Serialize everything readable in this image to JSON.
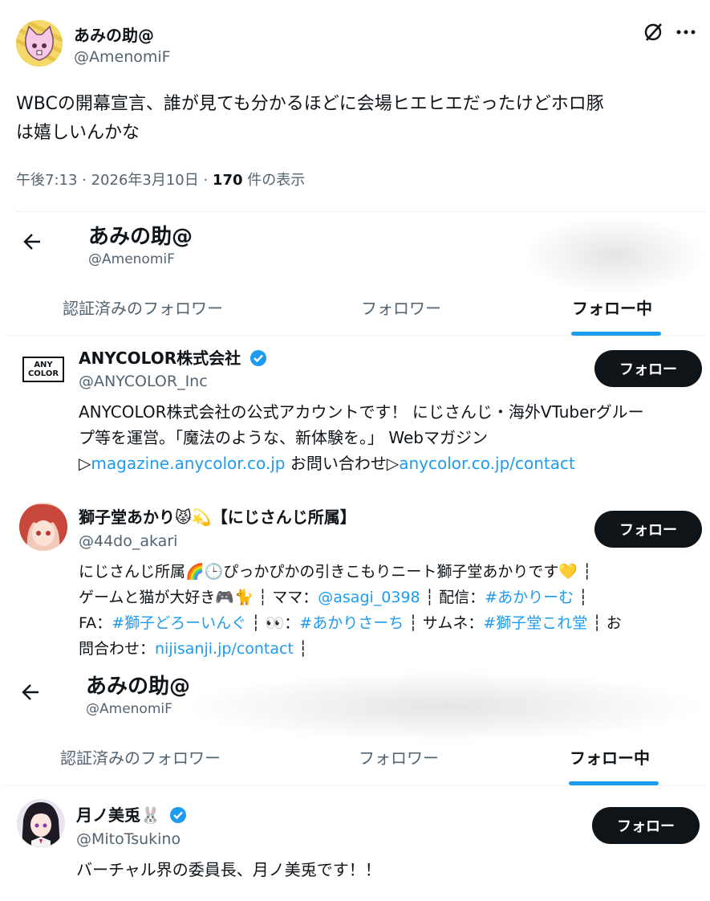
{
  "tweet": {
    "author_name": "あみの助@",
    "author_handle": "@AmenomiF",
    "text_line1": "WBCの開幕宣言、誰が見ても分かるほどに会場ヒエヒエだったけどホロ豚",
    "text_line2": "は嬉しいんかな",
    "time": "午後7:13 · 2026年3月10日 · ",
    "views_count": "170",
    "views_label": " 件の表示",
    "more_icon": "more-horizontal-icon",
    "grok_icon": "slash-circle-icon"
  },
  "screenshot1": {
    "back_icon": "arrow-left-icon",
    "profile_name": "あみの助@",
    "profile_handle": "@AmenomiF",
    "tabs": [
      "認証済みのフォロワー",
      "フォロワー",
      "フォロー中"
    ],
    "users": [
      {
        "name": "ANYCOLOR株式会社",
        "handle": "@ANYCOLOR_Inc",
        "follow": "フォロー",
        "logo_line1": "ANY",
        "logo_line2": "COLOR",
        "bio_l1": "ANYCOLOR株式会社の公式アカウントです！ にじさんじ・海外VTuberグルー",
        "bio_l2": "プ等を運営。「魔法のような、新体験を。」 Webマガジン",
        "bio_l3_a": "▷",
        "bio_l3_link1": "magazine.anycolor.co.jp",
        "bio_l3_b": " お問い合わせ▷",
        "bio_l3_link2": "anycolor.co.jp/contact"
      },
      {
        "name": "獅子堂あかり😾💫【にじさんじ所属】",
        "handle": "@44do_akari",
        "follow": "フォロー",
        "bio_l1": "にじさんじ所属🌈🕒ぴっかぴかの引きこもりニート獅子堂あかりです💛 ┆",
        "bio_l2_a": "ゲームと猫が大好き🎮🐈 ┆ ママ：",
        "bio_l2_link": "@asagi_0398",
        "bio_l2_b": " ┆ 配信：",
        "bio_l2_link2": "#あかりーむ",
        "bio_l2_c": " ┆",
        "bio_l3_a": "FA：",
        "bio_l3_link1": "#獅子どろーいんぐ",
        "bio_l3_b": " ┆ 👀：",
        "bio_l3_link2": "#あかりさーち",
        "bio_l3_c": " ┆ サムネ：",
        "bio_l3_link3": "#獅子堂これ堂",
        "bio_l3_d": " ┆ お",
        "bio_l4_a": "問合わせ：",
        "bio_l4_link": "nijisanji.jp/contact",
        "bio_l4_b": " ┆"
      }
    ]
  },
  "screenshot2": {
    "back_icon": "arrow-left-icon",
    "profile_name": "あみの助@",
    "profile_handle": "@AmenomiF",
    "tabs": [
      "認証済みのフォロワー",
      "フォロワー",
      "フォロー中"
    ],
    "users": [
      {
        "name": "月ノ美兎🐰",
        "handle": "@MitoTsukino",
        "follow": "フォロー",
        "bio_l1": "バーチャル界の委員長、月ノ美兎です！！"
      }
    ]
  },
  "colors": {
    "accent": "#1d9bf0",
    "text": "#0f1419",
    "muted": "#536471",
    "button": "#0f1419"
  }
}
